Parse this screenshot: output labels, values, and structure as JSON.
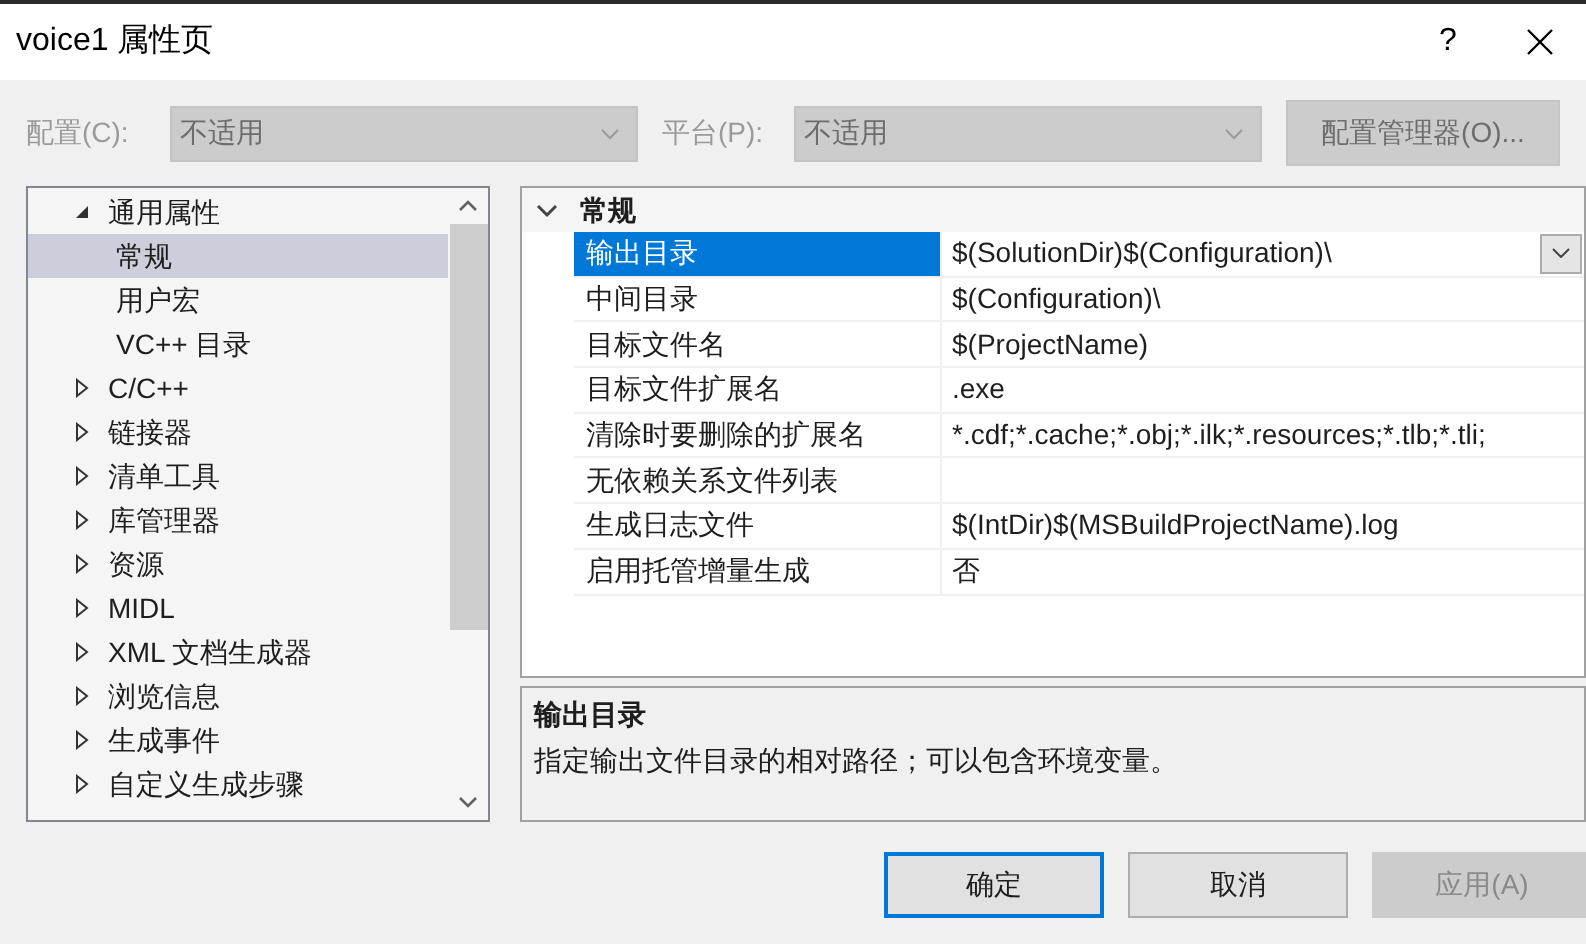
{
  "window": {
    "title": "voice1 属性页",
    "help": "?"
  },
  "toolbar": {
    "config_label": "配置(C):",
    "config_value": "不适用",
    "platform_label": "平台(P):",
    "platform_value": "不适用",
    "config_manager": "配置管理器(O)...",
    "disabled": true
  },
  "tree": {
    "items": [
      {
        "label": "通用属性",
        "expanded": true,
        "children": [
          {
            "label": "常规",
            "selected": true
          },
          {
            "label": "用户宏",
            "selected": false
          },
          {
            "label": "VC++ 目录",
            "selected": false
          }
        ]
      },
      {
        "label": "C/C++",
        "expanded": false
      },
      {
        "label": "链接器",
        "expanded": false
      },
      {
        "label": "清单工具",
        "expanded": false
      },
      {
        "label": "库管理器",
        "expanded": false
      },
      {
        "label": "资源",
        "expanded": false
      },
      {
        "label": "MIDL",
        "expanded": false
      },
      {
        "label": "XML 文档生成器",
        "expanded": false
      },
      {
        "label": "浏览信息",
        "expanded": false
      },
      {
        "label": "生成事件",
        "expanded": false
      },
      {
        "label": "自定义生成步骤",
        "expanded": false
      }
    ]
  },
  "grid": {
    "category": "常规",
    "expanded": true,
    "rows": [
      {
        "name": "输出目录",
        "value": "$(SolutionDir)$(Configuration)\\",
        "selected": true
      },
      {
        "name": "中间目录",
        "value": "$(Configuration)\\",
        "selected": false
      },
      {
        "name": "目标文件名",
        "value": "$(ProjectName)",
        "selected": false
      },
      {
        "name": "目标文件扩展名",
        "value": ".exe",
        "selected": false
      },
      {
        "name": "清除时要删除的扩展名",
        "value": "*.cdf;*.cache;*.obj;*.ilk;*.resources;*.tlb;*.tli;",
        "selected": false
      },
      {
        "name": "无依赖关系文件列表",
        "selected": false
      },
      {
        "name": "生成日志文件",
        "value": "$(IntDir)$(MSBuildProjectName).log",
        "selected": false
      },
      {
        "name": "启用托管增量生成",
        "value": "否",
        "selected": false
      }
    ]
  },
  "description": {
    "title": "输出目录",
    "text": "指定输出文件目录的相对路径；可以包含环境变量。"
  },
  "buttons": [
    {
      "label": "确定",
      "default": true,
      "disabled": false
    },
    {
      "label": "取消",
      "default": false,
      "disabled": false
    },
    {
      "label": "应用(A)",
      "default": false,
      "disabled": true
    }
  ]
}
